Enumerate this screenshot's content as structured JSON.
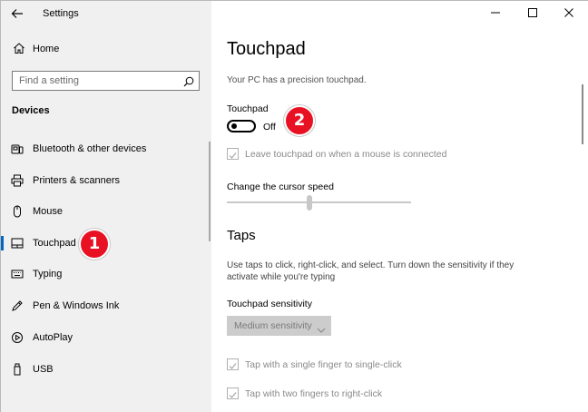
{
  "window": {
    "title": "Settings"
  },
  "sidebar": {
    "home_label": "Home",
    "search_placeholder": "Find a setting",
    "section_title": "Devices",
    "items": [
      {
        "label": "Bluetooth & other devices",
        "icon": "bluetooth-devices-icon",
        "selected": false
      },
      {
        "label": "Printers & scanners",
        "icon": "printer-icon",
        "selected": false
      },
      {
        "label": "Mouse",
        "icon": "mouse-icon",
        "selected": false
      },
      {
        "label": "Touchpad",
        "icon": "touchpad-icon",
        "selected": true
      },
      {
        "label": "Typing",
        "icon": "keyboard-icon",
        "selected": false
      },
      {
        "label": "Pen & Windows Ink",
        "icon": "pen-icon",
        "selected": false
      },
      {
        "label": "AutoPlay",
        "icon": "autoplay-icon",
        "selected": false
      },
      {
        "label": "USB",
        "icon": "usb-icon",
        "selected": false
      }
    ]
  },
  "annotations": {
    "step1": "1",
    "step2": "2",
    "badge_color": "#e81123"
  },
  "main": {
    "page_title": "Touchpad",
    "precision_note": "Your PC has a precision touchpad.",
    "touchpad_label": "Touchpad",
    "touchpad_toggle_state": "Off",
    "leave_on_label": "Leave touchpad on when a mouse is connected",
    "cursor_speed_label": "Change the cursor speed",
    "cursor_speed_fraction": 0.45,
    "taps_title": "Taps",
    "taps_description": "Use taps to click, right-click, and select. Turn down the sensitivity if they activate while you're typing",
    "sensitivity_label": "Touchpad sensitivity",
    "sensitivity_value": "Medium sensitivity",
    "single_tap_label": "Tap with a single finger to single-click",
    "two_finger_tap_label": "Tap with two fingers to right-click"
  },
  "colors": {
    "accent": "#0067c0",
    "sidebar_bg": "#f0f0f0",
    "disabled_text": "#8a8a8a"
  }
}
